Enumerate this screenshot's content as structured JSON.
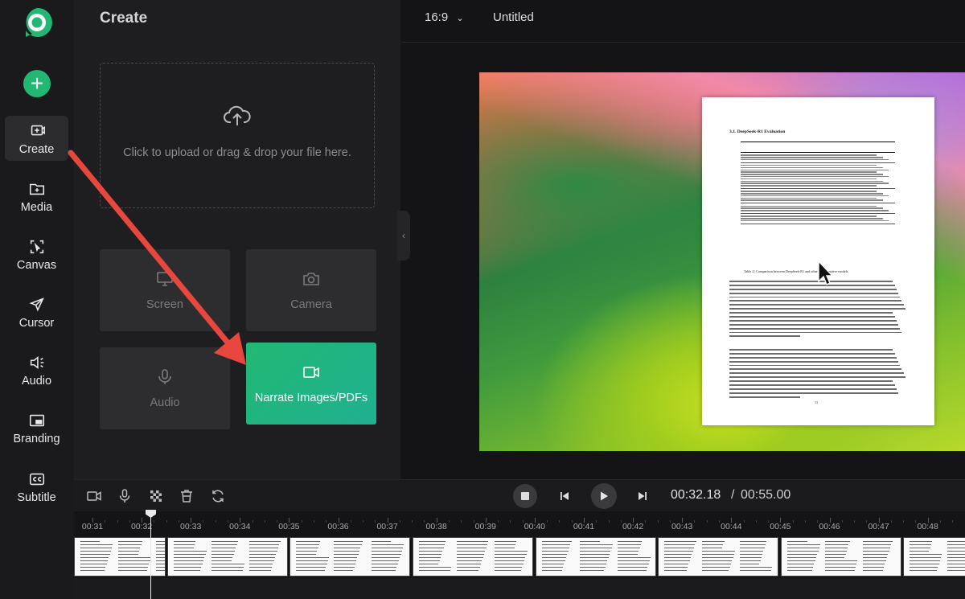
{
  "colors": {
    "accent": "#22b873",
    "arrow": "#e8473e"
  },
  "sidebar": {
    "items": [
      {
        "label": "Create",
        "icon": "add-media-icon",
        "active": true
      },
      {
        "label": "Media",
        "icon": "folder-plus-icon"
      },
      {
        "label": "Canvas",
        "icon": "canvas-icon"
      },
      {
        "label": "Cursor",
        "icon": "cursor-icon"
      },
      {
        "label": "Audio",
        "icon": "speaker-icon"
      },
      {
        "label": "Branding",
        "icon": "branding-icon"
      },
      {
        "label": "Subtitle",
        "icon": "cc-icon"
      }
    ]
  },
  "panel": {
    "title": "Create",
    "upload_text": "Click to upload or drag & drop your file here.",
    "tiles": [
      {
        "label": "Screen",
        "icon": "monitor-icon"
      },
      {
        "label": "Camera",
        "icon": "camera-icon"
      },
      {
        "label": "Audio",
        "icon": "microphone-icon"
      },
      {
        "label": "Narrate Images/PDFs",
        "icon": "video-icon",
        "highlighted": true
      }
    ]
  },
  "header": {
    "aspect_ratio": "16:9",
    "title": "Untitled"
  },
  "document": {
    "heading": "3.1.  DeepSeek-R1 Evaluation",
    "caption": "Table 4 | Comparison between DeepSeek-R1 and other representative models.",
    "page_number": "13"
  },
  "transport": {
    "current_time": "00:32.18",
    "separator": "/",
    "total_time": "00:55.00"
  },
  "timeline": {
    "ticks": [
      "00:31",
      "00:32",
      "00:33",
      "00:34",
      "00:35",
      "00:36",
      "00:37",
      "00:38",
      "00:39",
      "00:40",
      "00:41",
      "00:42",
      "00:43",
      "00:44",
      "00:45",
      "00:46",
      "00:47",
      "00:48"
    ],
    "playhead_time": "00:32.18"
  }
}
